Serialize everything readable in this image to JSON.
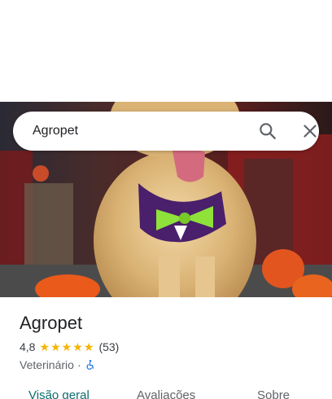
{
  "search": {
    "query": "Agropet"
  },
  "icons": {
    "search": "search-icon",
    "close": "close-icon",
    "accessibility": "wheelchair-icon",
    "star": "star-icon"
  },
  "place": {
    "name": "Agropet",
    "rating": "4,8",
    "stars": 5,
    "review_count": "(53)",
    "category": "Veterinário",
    "separator": "·"
  },
  "tabs": [
    {
      "label": "Visão geral",
      "active": true
    },
    {
      "label": "Avaliações",
      "active": false
    },
    {
      "label": "Sobre",
      "active": false
    }
  ],
  "colors": {
    "accent": "#0b6e6e",
    "star": "#f5b400",
    "accessibility": "#1a73e8"
  }
}
